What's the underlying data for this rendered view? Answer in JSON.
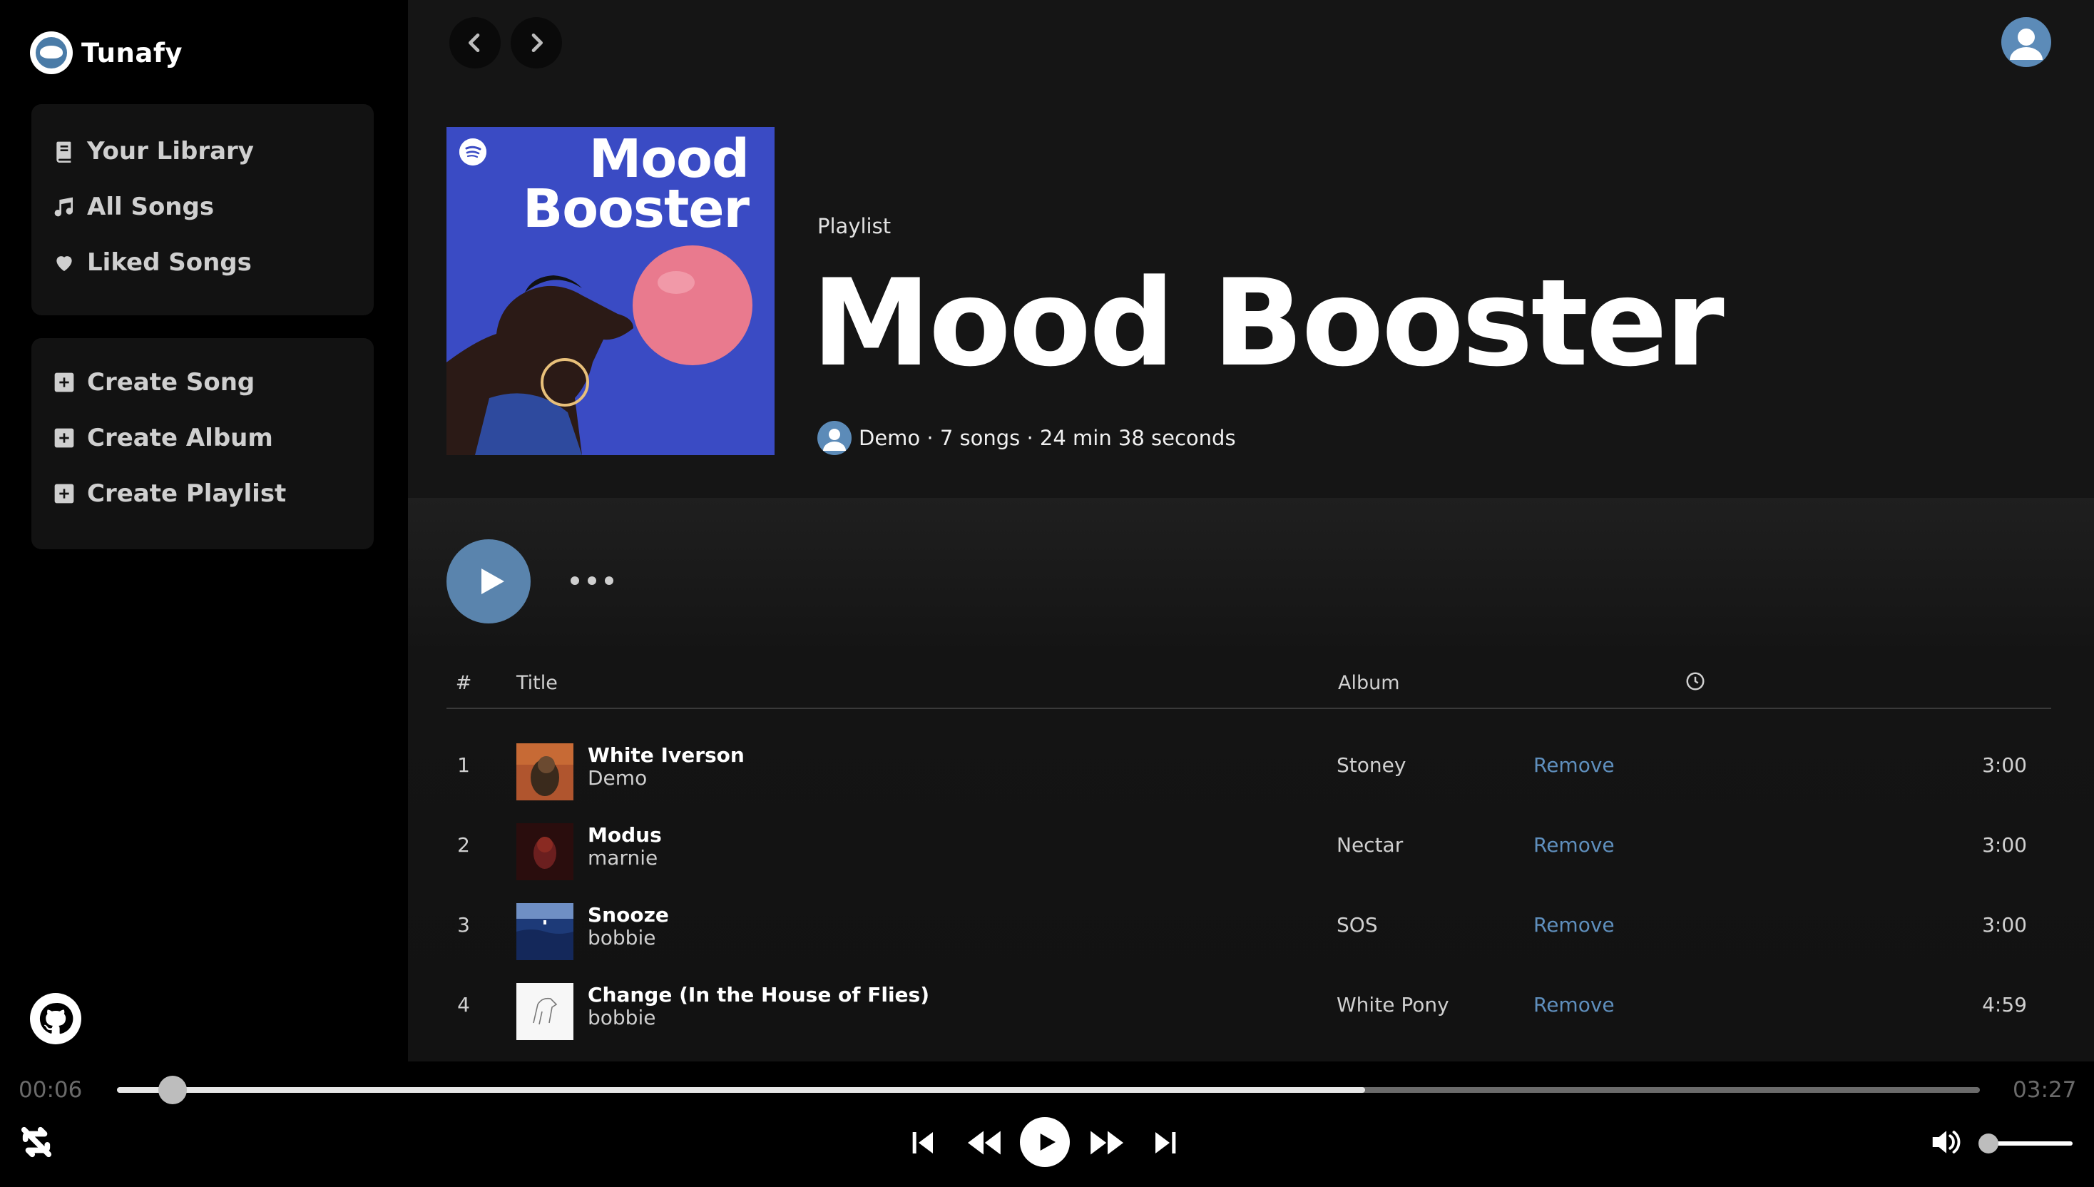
{
  "app": {
    "name": "Tunafy"
  },
  "sidebar": {
    "nav": [
      {
        "label": "Your Library",
        "icon": "book-icon"
      },
      {
        "label": "All Songs",
        "icon": "music-note-icon"
      },
      {
        "label": "Liked Songs",
        "icon": "heart-icon"
      }
    ],
    "create": [
      {
        "label": "Create Song",
        "icon": "plus-square-icon"
      },
      {
        "label": "Create Album",
        "icon": "plus-square-icon"
      },
      {
        "label": "Create Playlist",
        "icon": "plus-square-icon"
      }
    ],
    "footer_icon": "github-icon"
  },
  "playlist": {
    "type_label": "Playlist",
    "title": "Mood Booster",
    "cover_line1": "Mood",
    "cover_line2": "Booster",
    "meta": "Demo · 7 songs · 24 min 38 seconds"
  },
  "table": {
    "headers": {
      "num": "#",
      "title": "Title",
      "album": "Album",
      "duration_icon": "clock-icon"
    },
    "remove_label": "Remove",
    "rows": [
      {
        "num": "1",
        "title": "White Iverson",
        "artist": "Demo",
        "album": "Stoney",
        "duration": "3:00"
      },
      {
        "num": "2",
        "title": "Modus",
        "artist": "marnie",
        "album": "Nectar",
        "duration": "3:00"
      },
      {
        "num": "3",
        "title": "Snooze",
        "artist": "bobbie",
        "album": "SOS",
        "duration": "3:00"
      },
      {
        "num": "4",
        "title": "Change (In the House of Flies)",
        "artist": "bobbie",
        "album": "White Pony",
        "duration": "4:59"
      }
    ]
  },
  "player": {
    "current_time": "00:06",
    "total_time": "03:27",
    "progress_fraction": 0.03,
    "buffered_fraction": 0.67,
    "volume_fraction": 0.0
  },
  "colors": {
    "accent": "#5a84ad",
    "remove_link": "#5f8fbd",
    "sidebar_bg": "#000000",
    "panel_bg": "#121212",
    "main_bg": "#121212"
  }
}
